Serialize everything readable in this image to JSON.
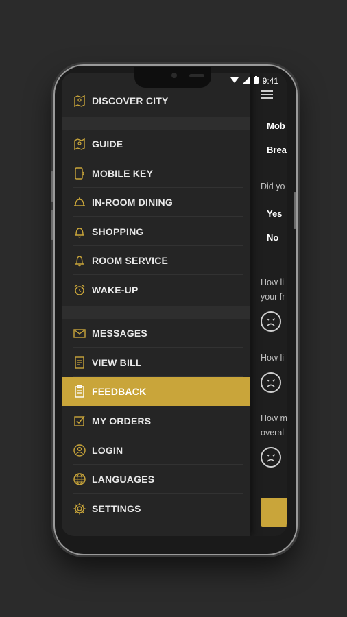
{
  "status_bar": {
    "time": "9:41"
  },
  "menu": {
    "top_item": {
      "label": "DISCOVER CITY",
      "icon": "map-pin-icon"
    },
    "group1": [
      {
        "label": "GUIDE",
        "icon": "map-icon"
      },
      {
        "label": "MOBILE KEY",
        "icon": "phone-key-icon"
      },
      {
        "label": "IN-ROOM DINING",
        "icon": "cloche-icon"
      },
      {
        "label": "SHOPPING",
        "icon": "bell-icon"
      },
      {
        "label": "ROOM SERVICE",
        "icon": "bell-icon"
      },
      {
        "label": "WAKE-UP",
        "icon": "alarm-clock-icon"
      }
    ],
    "group2": [
      {
        "label": "MESSAGES",
        "icon": "envelope-icon"
      },
      {
        "label": "VIEW BILL",
        "icon": "bill-icon"
      },
      {
        "label": "FEEDBACK",
        "icon": "clipboard-icon",
        "active": true
      },
      {
        "label": "MY ORDERS",
        "icon": "checkbox-icon"
      },
      {
        "label": "LOGIN",
        "icon": "user-circle-icon"
      },
      {
        "label": "LANGUAGES",
        "icon": "globe-icon"
      },
      {
        "label": "SETTINGS",
        "icon": "gear-icon"
      }
    ],
    "accent_color": "#c9a53a"
  },
  "feedback_panel": {
    "options1": [
      "Mob",
      "Brea"
    ],
    "question1": "Did yo",
    "options2": [
      "Yes",
      "No"
    ],
    "question2_line1": "How li",
    "question2_line2": "your fr",
    "question3": "How li",
    "question4_line1": "How m",
    "question4_line2": "overal"
  }
}
